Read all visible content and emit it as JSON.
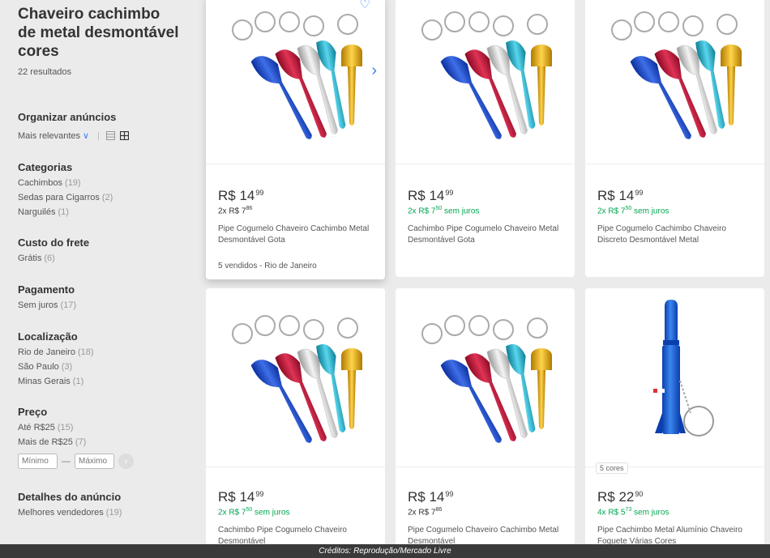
{
  "sidebar": {
    "title": "Chaveiro cachimbo de metal desmontável cores",
    "results": "22 resultados",
    "sort": {
      "heading": "Organizar anúncios",
      "value": "Mais relevantes"
    },
    "categories": {
      "heading": "Categorias",
      "items": [
        {
          "label": "Cachimbos",
          "count": "(19)"
        },
        {
          "label": "Sedas para Cigarros",
          "count": "(2)"
        },
        {
          "label": "Narguilés",
          "count": "(1)"
        }
      ]
    },
    "shipping": {
      "heading": "Custo do frete",
      "items": [
        {
          "label": "Grátis",
          "count": "(6)"
        }
      ]
    },
    "payment": {
      "heading": "Pagamento",
      "items": [
        {
          "label": "Sem juros",
          "count": "(17)"
        }
      ]
    },
    "location": {
      "heading": "Localização",
      "items": [
        {
          "label": "Rio de Janeiro",
          "count": "(18)"
        },
        {
          "label": "São Paulo",
          "count": "(3)"
        },
        {
          "label": "Minas Gerais",
          "count": "(1)"
        }
      ]
    },
    "price": {
      "heading": "Preço",
      "items": [
        {
          "label": "Até R$25",
          "count": "(15)"
        },
        {
          "label": "Mais de R$25",
          "count": "(7)"
        }
      ],
      "min_placeholder": "Mínimo",
      "max_placeholder": "Máximo"
    },
    "details": {
      "heading": "Detalhes do anúncio",
      "items": [
        {
          "label": "Melhores vendedores",
          "count": "(19)"
        }
      ]
    }
  },
  "products": [
    {
      "price": "R$ 14",
      "cents": "99",
      "inst": "2x R$ 7",
      "inst_cents": "86",
      "inst_extra": "",
      "title": "Pipe Cogumelo Chaveiro Cachimbo Metal Desmontável Gota",
      "sold": "5 vendidos - Rio de Janeiro"
    },
    {
      "price": "R$ 14",
      "cents": "99",
      "inst": "2x R$ 7",
      "inst_cents": "50",
      "inst_extra": " sem juros",
      "title": "Cachimbo Pipe Cogumelo Chaveiro Metal Desmontável Gota"
    },
    {
      "price": "R$ 14",
      "cents": "99",
      "inst": "2x R$ 7",
      "inst_cents": "50",
      "inst_extra": " sem juros",
      "title": "Pipe Cogumelo Cachimbo Chaveiro Discreto Desmontável Metal"
    },
    {
      "price": "R$ 14",
      "cents": "99",
      "inst": "2x R$ 7",
      "inst_cents": "50",
      "inst_extra": " sem juros",
      "title": "Cachimbo Pipe Cogumelo Chaveiro Desmontável"
    },
    {
      "price": "R$ 14",
      "cents": "99",
      "inst": "2x R$ 7",
      "inst_cents": "86",
      "inst_extra": "",
      "title": "Pipe Cogumelo Chaveiro Cachimbo Metal Desmontável"
    },
    {
      "price": "R$ 22",
      "cents": "90",
      "inst": "4x R$ 5",
      "inst_cents": "73",
      "inst_extra": " sem juros",
      "title": "Pipe Cachimbo Metal Alumínio Chaveiro Foguete Várias Cores",
      "badge": "5 cores"
    }
  ],
  "colors": {
    "accent": "#3483fa",
    "green": "#00a650"
  },
  "credit": "Créditos: Reprodução/Mercado Livre"
}
